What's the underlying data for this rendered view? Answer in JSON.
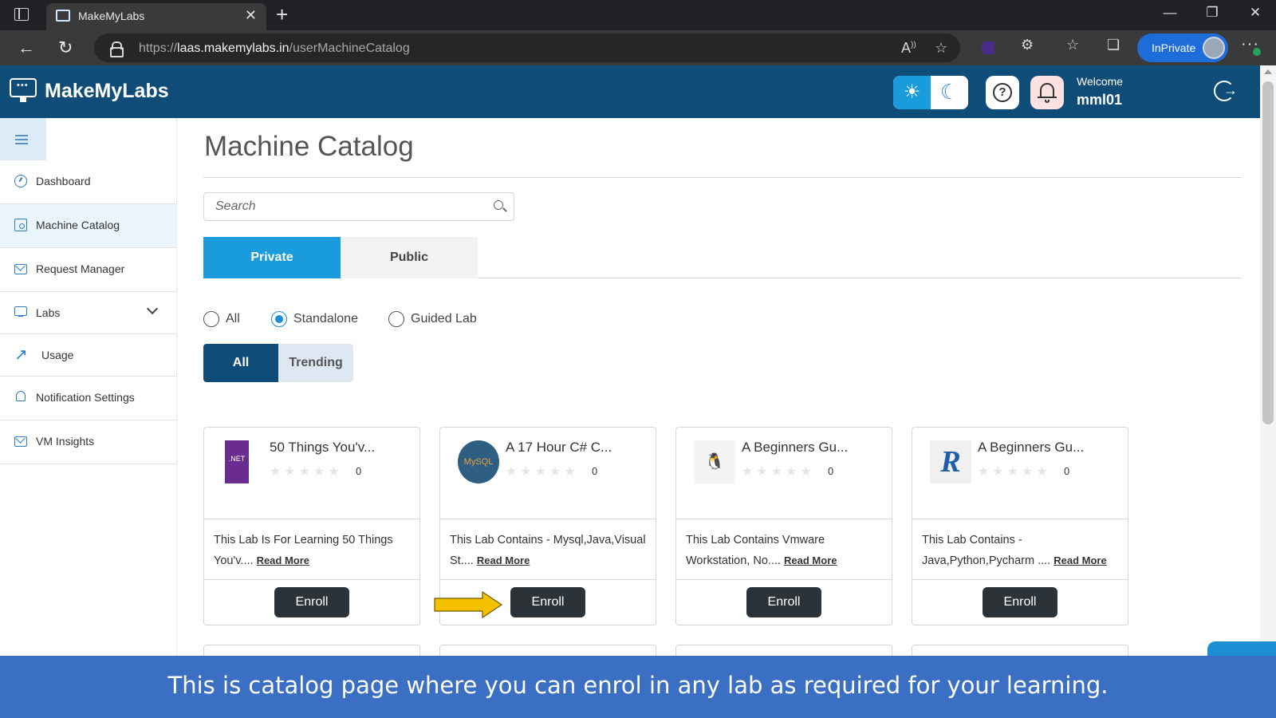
{
  "browser": {
    "tab_title": "MakeMyLabs",
    "url_prefix": "https://",
    "url_host": "laas.makemylabs.in",
    "url_path": "/userMachineCatalog",
    "inprivate_label": "InPrivate"
  },
  "header": {
    "brand": "MakeMyLabs",
    "welcome": "Welcome",
    "username": "mml01",
    "accent_color": "#0f4d78"
  },
  "sidebar": {
    "items": [
      {
        "label": "Dashboard",
        "icon": "dashboard-icon"
      },
      {
        "label": "Machine Catalog",
        "icon": "catalog-icon",
        "active": true
      },
      {
        "label": "Request Manager",
        "icon": "mail-icon"
      },
      {
        "label": "Labs",
        "icon": "monitor-icon",
        "expandable": true
      },
      {
        "label": "Usage",
        "icon": "chart-line-icon"
      },
      {
        "label": "Notification Settings",
        "icon": "bell-icon"
      },
      {
        "label": "VM Insights",
        "icon": "mail-icon"
      }
    ]
  },
  "main": {
    "title": "Machine Catalog",
    "search_placeholder": "Search",
    "visibility_tabs": [
      {
        "label": "Private",
        "selected": true
      },
      {
        "label": "Public",
        "selected": false
      }
    ],
    "type_filters": [
      {
        "label": "All",
        "checked": false
      },
      {
        "label": "Standalone",
        "checked": true
      },
      {
        "label": "Guided Lab",
        "checked": false
      }
    ],
    "list_filters": [
      {
        "label": "All",
        "selected": true
      },
      {
        "label": "Trending",
        "selected": false
      }
    ],
    "cards": [
      {
        "title": "50 Things You'v...",
        "stars": "★★★★★",
        "rating": "0",
        "description": "This Lab Is For Learning 50 Things You'v....",
        "read_more": "Read More",
        "enroll_label": "Enroll",
        "logo_text": ".NET"
      },
      {
        "title": "A 17 Hour C# C...",
        "stars": "★★★★★",
        "rating": "0",
        "description": "This Lab Contains - Mysql,Java,Visual St....",
        "read_more": "Read More",
        "enroll_label": "Enroll",
        "logo_text": "MySQL"
      },
      {
        "title": "A Beginners Gu...",
        "stars": "★★★★★",
        "rating": "0",
        "description": "This Lab Contains Vmware Workstation, No....",
        "read_more": "Read More",
        "enroll_label": "Enroll",
        "logo_text": ""
      },
      {
        "title": "A Beginners Gu...",
        "stars": "★★★★★",
        "rating": "0",
        "description": "This Lab Contains - Java,Python,Pycharm ....",
        "read_more": "Read More",
        "enroll_label": "Enroll",
        "logo_text": ""
      }
    ]
  },
  "caption": {
    "text": "This is catalog page where you can enrol in any lab as required for your learning."
  }
}
